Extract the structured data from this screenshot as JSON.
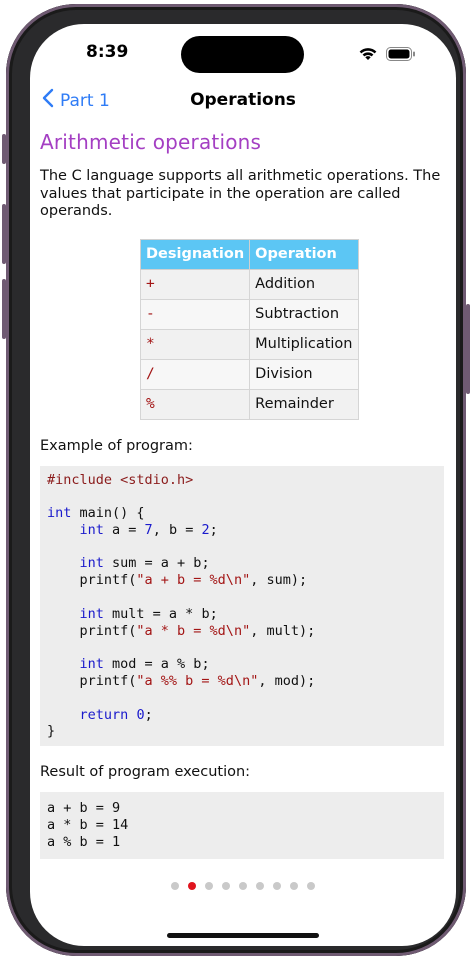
{
  "status": {
    "time": "8:39"
  },
  "nav": {
    "back_label": "Part 1",
    "title": "Operations"
  },
  "section": {
    "heading": "Arithmetic operations",
    "intro": "The C language supports all arithmetic operations. The values that participate in the operation are called operands."
  },
  "table": {
    "headers": [
      "Designation",
      "Operation"
    ],
    "rows": [
      {
        "symbol": "+",
        "operation": "Addition"
      },
      {
        "symbol": "-",
        "operation": "Subtraction"
      },
      {
        "symbol": "*",
        "operation": "Multiplication"
      },
      {
        "symbol": "/",
        "operation": "Division"
      },
      {
        "symbol": "%",
        "operation": "Remainder"
      }
    ]
  },
  "example_label": "Example of program:",
  "code_lines": [
    "#include <stdio.h>",
    "",
    "int main() {",
    "    int a = 7, b = 2;",
    "",
    "    int sum = a + b;",
    "    printf(\"a + b = %d\\n\", sum);",
    "",
    "    int mult = a * b;",
    "    printf(\"a * b = %d\\n\", mult);",
    "",
    "    int mod = a % b;",
    "    printf(\"a %% b = %d\\n\", mod);",
    "",
    "    return 0;",
    "}"
  ],
  "result_label": "Result of program execution:",
  "result_lines": [
    "a + b = 9",
    "a * b = 14",
    "a % b = 1"
  ],
  "pager": {
    "count": 9,
    "active_index": 1
  },
  "colors": {
    "accent": "#2f7cf6",
    "heading": "#a43fc3",
    "table_header": "#5cc6f4",
    "active_dot": "#e0141e"
  }
}
